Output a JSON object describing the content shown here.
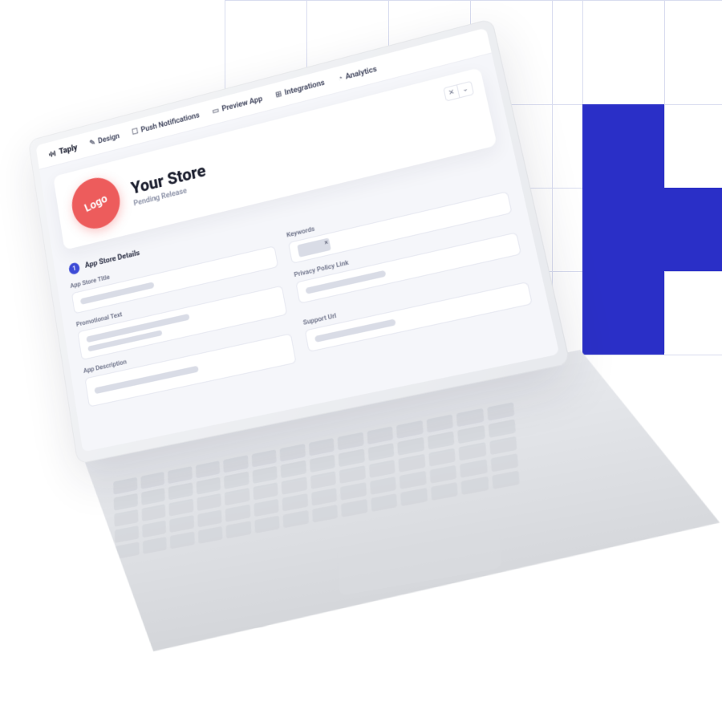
{
  "brand": {
    "name": "Taply"
  },
  "nav": {
    "items": [
      {
        "label": "Design",
        "icon": "✎"
      },
      {
        "label": "Push Notifications",
        "icon": "☐"
      },
      {
        "label": "Preview App",
        "icon": "▭"
      },
      {
        "label": "Integrations",
        "icon": "⊞"
      },
      {
        "label": "Analytics",
        "icon": "◔"
      }
    ]
  },
  "store": {
    "logo_text": "Logo",
    "title": "Your Store",
    "status": "Pending Release"
  },
  "section": {
    "step": "1",
    "title": "App Store Details"
  },
  "fields": {
    "app_store_title": "App Store Title",
    "keywords": "Keywords",
    "promotional_text": "Promotional Text",
    "privacy_policy_link": "Privacy Policy Link",
    "app_description": "App Description",
    "support_url": "Support Url"
  },
  "colors": {
    "accent_blue": "#2a2fc7",
    "logo_red": "#ed5c5c",
    "step_blue": "#3c4ad6"
  }
}
